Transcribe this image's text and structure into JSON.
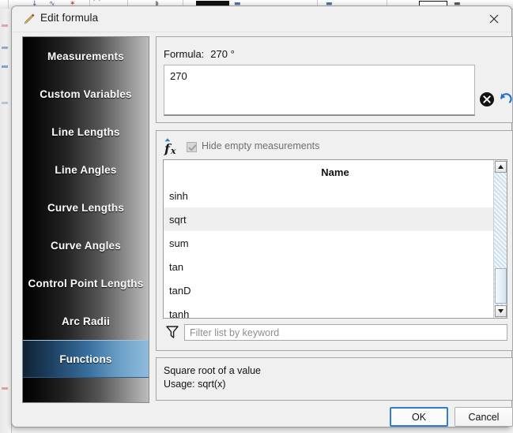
{
  "window": {
    "title": "Edit formula",
    "title_icon": "pencil-icon",
    "close_icon": "close-icon"
  },
  "sidebar": {
    "items": [
      {
        "label": "Measurements",
        "selected": false
      },
      {
        "label": "Custom Variables",
        "selected": false
      },
      {
        "label": "Line Lengths",
        "selected": false
      },
      {
        "label": "Line Angles",
        "selected": false
      },
      {
        "label": "Curve Lengths",
        "selected": false
      },
      {
        "label": "Curve Angles",
        "selected": false
      },
      {
        "label": "Control Point Lengths",
        "selected": false
      },
      {
        "label": "Arc Radii",
        "selected": false
      },
      {
        "label": "Functions",
        "selected": true
      }
    ]
  },
  "formula": {
    "label": "Formula:",
    "result": "270 °",
    "value": "270",
    "clear_icon": "clear-circle-icon",
    "undo_icon": "undo-arrow-icon"
  },
  "functions_panel": {
    "fx_icon": "fx-icon",
    "hide_empty_label": "Hide empty measurements",
    "hide_empty_checked": true,
    "column_header": "Name",
    "rows": [
      {
        "name": "sinh",
        "selected": false
      },
      {
        "name": "sqrt",
        "selected": true
      },
      {
        "name": "sum",
        "selected": false
      },
      {
        "name": "tan",
        "selected": false
      },
      {
        "name": "tanD",
        "selected": false
      },
      {
        "name": "tanh",
        "selected": false
      }
    ],
    "filter_icon": "filter-funnel-icon",
    "filter_placeholder": "Filter list by keyword",
    "filter_value": "",
    "scrollbar": {
      "up_icon": "scroll-up-arrow-icon",
      "down_icon": "scroll-down-arrow-icon"
    }
  },
  "description": {
    "line1": "Square root of a value",
    "line2": "Usage: sqrt(x)"
  },
  "buttons": {
    "ok": "OK",
    "cancel": "Cancel"
  },
  "colors": {
    "accent": "#2c7fd4",
    "selected_sidebar": "#386f9e",
    "undo_blue": "#1f6fd0"
  }
}
